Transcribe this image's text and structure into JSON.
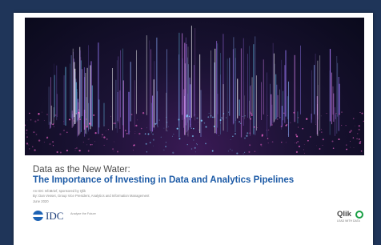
{
  "cover": {
    "subtitle": "Data as the New Water:",
    "title": "The Importance of Investing in Data and Analytics Pipelines",
    "brief_line": "An IDC InfoBrief, sponsored by Qlik",
    "author_line": "By: Dan Vesset, Group Vice President, Analytics and Information Management",
    "date": "June 2020"
  },
  "logos": {
    "idc": "IDC",
    "idc_tagline": "Analyze the Future",
    "qlik": "Qlik",
    "qlik_tagline": "LEAD WITH DATA"
  },
  "colors": {
    "background": "#1f3559",
    "title_blue": "#1c5aa6",
    "qlik_green": "#1aa046"
  }
}
